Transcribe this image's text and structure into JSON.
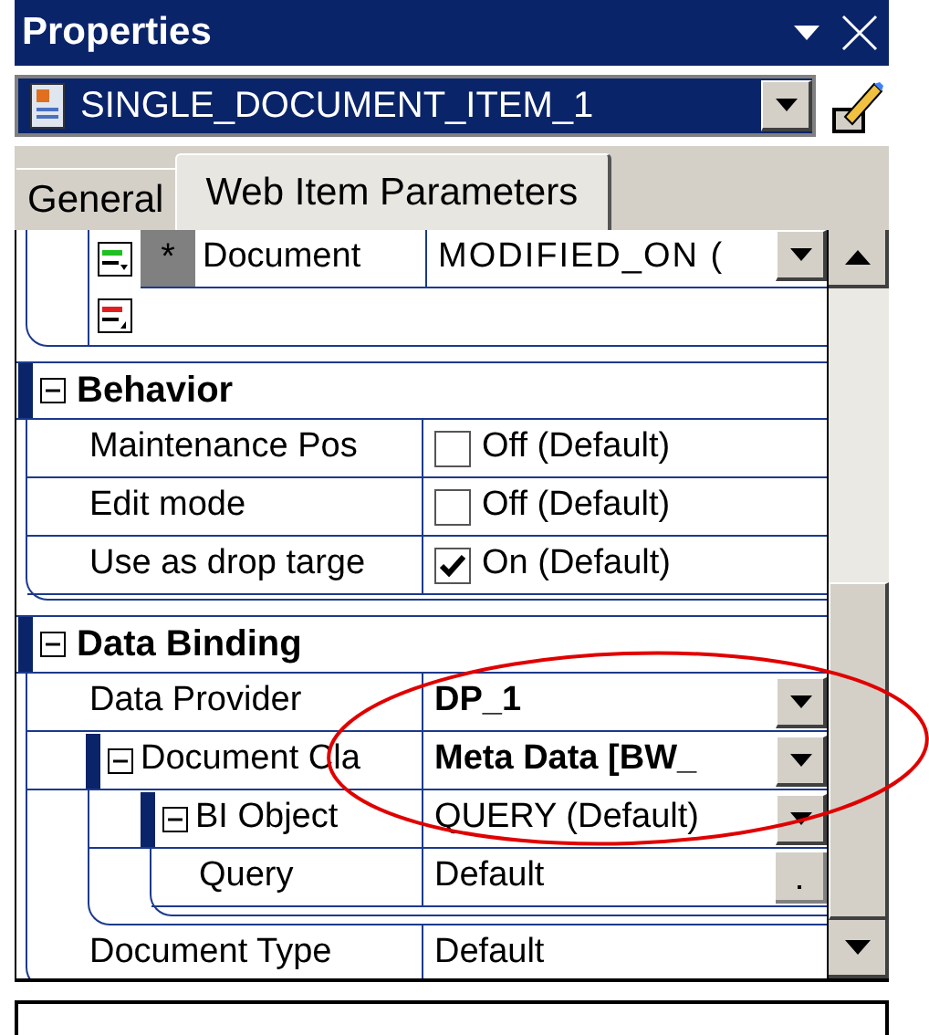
{
  "title": "Properties",
  "object_selector": {
    "value": "SINGLE_DOCUMENT_ITEM_1"
  },
  "tabs": [
    {
      "label": "General",
      "selected": false
    },
    {
      "label": "Web Item Parameters",
      "selected": true
    }
  ],
  "top_rows": [
    {
      "marker": "*",
      "label": "Document",
      "value": "MODIFIED_ON ("
    }
  ],
  "sections": [
    {
      "title": "Behavior",
      "expanded": true,
      "rows": [
        {
          "kind": "checkbox",
          "label": "Maintenance Pos",
          "checked": false,
          "value": "Off (Default)"
        },
        {
          "kind": "checkbox",
          "label": "Edit mode",
          "checked": false,
          "value": "Off (Default)"
        },
        {
          "kind": "checkbox",
          "label": "Use as drop targe",
          "checked": true,
          "value": "On (Default)"
        }
      ]
    },
    {
      "title": "Data Binding",
      "expanded": true,
      "rows": [
        {
          "kind": "dropdown",
          "label": "Data Provider",
          "value": "DP_1",
          "bold": true
        },
        {
          "kind": "group",
          "label": "Document Cla",
          "value": "Meta Data [BW_",
          "bold": true,
          "expanded": true,
          "children": [
            {
              "kind": "group",
              "label": "BI Object",
              "value": "QUERY (Default)",
              "bold": false,
              "expanded": true,
              "children": [
                {
                  "kind": "ellipsis",
                  "label": "Query",
                  "value": "Default"
                }
              ]
            }
          ]
        },
        {
          "kind": "text",
          "label": "Document Type",
          "value": "Default"
        }
      ]
    }
  ]
}
